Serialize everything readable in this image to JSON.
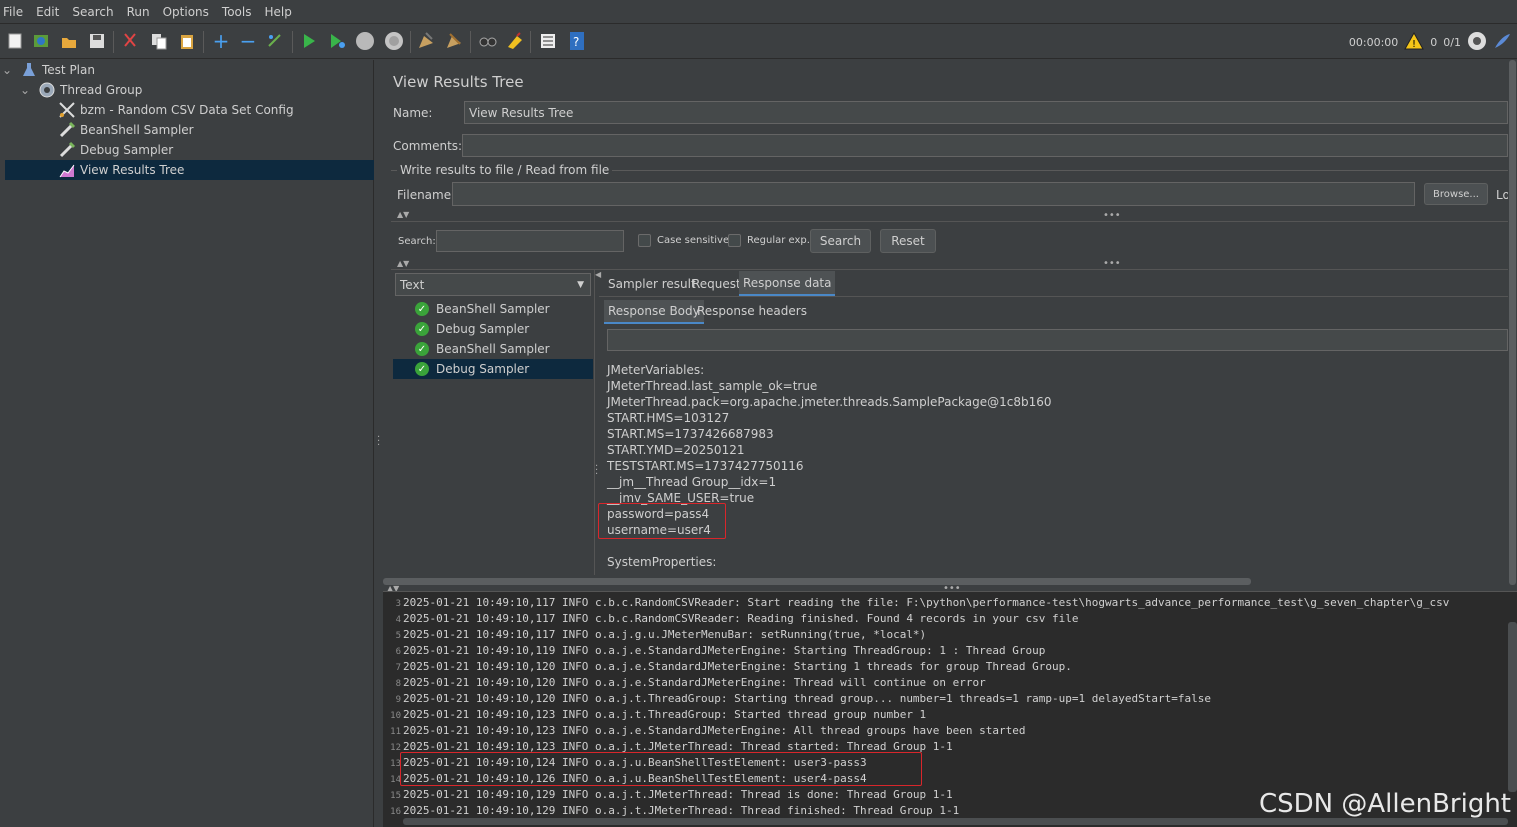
{
  "menu": [
    "File",
    "Edit",
    "Search",
    "Run",
    "Options",
    "Tools",
    "Help"
  ],
  "toolbar": {
    "timer": "00:00:00",
    "warning_count": "0",
    "threads": "0/1",
    "icons": [
      "new-icon",
      "templates-icon",
      "open-icon",
      "save-icon",
      "cut-icon",
      "copy-icon",
      "paste-icon",
      "expand-icon",
      "collapse-icon",
      "toggle-icon",
      "start-icon",
      "start-no-pause-icon",
      "stop-icon",
      "shutdown-icon",
      "clear-icon",
      "clear-all-icon",
      "search-icon",
      "reset-search-icon",
      "function-helper-icon",
      "help-icon"
    ]
  },
  "tree": [
    {
      "label": "Test Plan",
      "icon": "flask-icon",
      "level": 0
    },
    {
      "label": "Thread Group",
      "icon": "gear-icon",
      "level": 1
    },
    {
      "label": "bzm - Random CSV Data Set Config",
      "icon": "scissors-icon",
      "level": 2
    },
    {
      "label": "BeanShell Sampler",
      "icon": "pipette-icon",
      "level": 2
    },
    {
      "label": "Debug Sampler",
      "icon": "pipette-icon",
      "level": 2
    },
    {
      "label": "View Results Tree",
      "icon": "chart-icon",
      "level": 2,
      "selected": true
    }
  ],
  "panel": {
    "title": "View Results Tree",
    "name_label": "Name:",
    "name_value": "View Results Tree",
    "comments_label": "Comments:",
    "comments_value": "",
    "file_section": "Write results to file / Read from file",
    "filename_label": "Filename",
    "filename_value": "",
    "browse": "Browse...",
    "log_cut": "Lo",
    "search_label": "Search:",
    "search_value": "",
    "case_sensitive": "Case sensitive",
    "regular_exp": "Regular exp.",
    "search_btn": "Search",
    "reset_btn": "Reset",
    "renderer": "Text",
    "samplers": [
      "BeanShell Sampler",
      "Debug Sampler",
      "BeanShell Sampler",
      "Debug Sampler"
    ],
    "tabs": [
      "Sampler result",
      "Request",
      "Response data"
    ],
    "subtabs": [
      "Response Body",
      "Response headers"
    ],
    "response_lines": [
      "JMeterVariables:",
      "JMeterThread.last_sample_ok=true",
      "JMeterThread.pack=org.apache.jmeter.threads.SamplePackage@1c8b160",
      "START.HMS=103127",
      "START.MS=1737426687983",
      "START.YMD=20250121",
      "TESTSTART.MS=1737427750116",
      "__jm__Thread Group__idx=1",
      "__jmv_SAME_USER=true",
      "password=pass4",
      "username=user4",
      "",
      "SystemProperties:"
    ]
  },
  "log": [
    {
      "n": "3",
      "text": "2025-01-21 10:49:10,117 INFO c.b.c.RandomCSVReader: Start reading the file: F:\\python\\performance-test\\hogwarts_advance_performance_test\\g_seven_chapter\\g_csv"
    },
    {
      "n": "4",
      "text": "2025-01-21 10:49:10,117 INFO c.b.c.RandomCSVReader: Reading finished. Found 4 records in your csv file"
    },
    {
      "n": "5",
      "text": "2025-01-21 10:49:10,117 INFO o.a.j.g.u.JMeterMenuBar: setRunning(true, *local*)"
    },
    {
      "n": "6",
      "text": "2025-01-21 10:49:10,119 INFO o.a.j.e.StandardJMeterEngine: Starting ThreadGroup: 1 : Thread Group"
    },
    {
      "n": "7",
      "text": "2025-01-21 10:49:10,120 INFO o.a.j.e.StandardJMeterEngine: Starting 1 threads for group Thread Group."
    },
    {
      "n": "8",
      "text": "2025-01-21 10:49:10,120 INFO o.a.j.e.StandardJMeterEngine: Thread will continue on error"
    },
    {
      "n": "9",
      "text": "2025-01-21 10:49:10,120 INFO o.a.j.t.ThreadGroup: Starting thread group... number=1 threads=1 ramp-up=1 delayedStart=false"
    },
    {
      "n": "10",
      "text": "2025-01-21 10:49:10,123 INFO o.a.j.t.ThreadGroup: Started thread group number 1"
    },
    {
      "n": "11",
      "text": "2025-01-21 10:49:10,123 INFO o.a.j.e.StandardJMeterEngine: All thread groups have been started"
    },
    {
      "n": "12",
      "text": "2025-01-21 10:49:10,123 INFO o.a.j.t.JMeterThread: Thread started: Thread Group 1-1"
    },
    {
      "n": "13",
      "text": "2025-01-21 10:49:10,124 INFO o.a.j.u.BeanShellTestElement: user3-pass3"
    },
    {
      "n": "14",
      "text": "2025-01-21 10:49:10,126 INFO o.a.j.u.BeanShellTestElement: user4-pass4"
    },
    {
      "n": "15",
      "text": "2025-01-21 10:49:10,129 INFO o.a.j.t.JMeterThread: Thread is done: Thread Group 1-1"
    },
    {
      "n": "16",
      "text": "2025-01-21 10:49:10,129 INFO o.a.j.t.JMeterThread: Thread finished: Thread Group 1-1"
    }
  ],
  "watermark": "CSDN @AllenBright"
}
